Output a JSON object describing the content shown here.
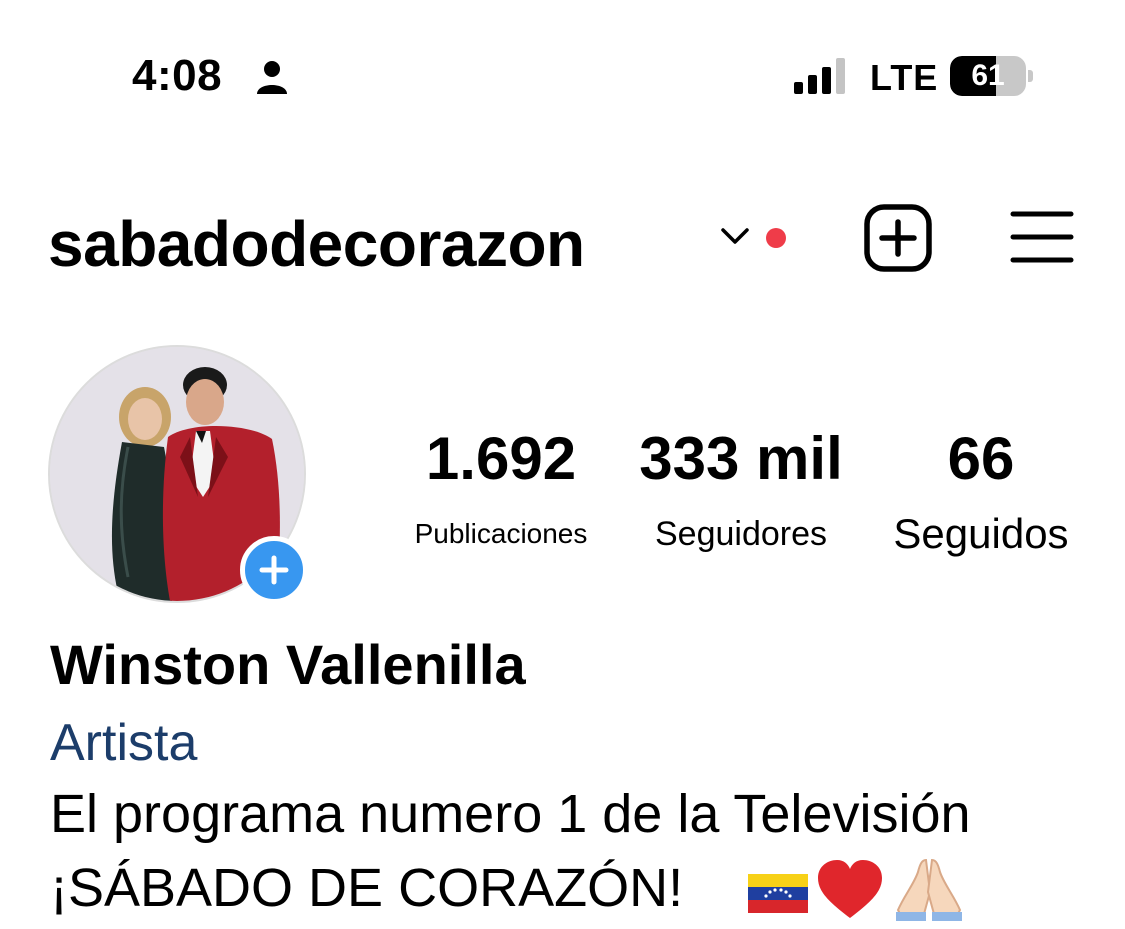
{
  "status_bar": {
    "time": "4:08",
    "network": "LTE",
    "battery_level": "61",
    "battery_fraction": 0.61,
    "icons": [
      "person-icon",
      "signal-icon",
      "battery-icon"
    ]
  },
  "header": {
    "username": "sabadodecorazon",
    "icons": [
      "chevron-down-icon",
      "notification-dot",
      "new-post-icon",
      "menu-icon"
    ],
    "notification_color": "#ef3c49"
  },
  "profile": {
    "avatar": "profile-photo",
    "add_story_icon": "plus-icon",
    "add_story_color": "#3897f0",
    "stats": [
      {
        "value": "1.692",
        "label": "Publicaciones"
      },
      {
        "value": "333 mil",
        "label": "Seguidores"
      },
      {
        "value": "66",
        "label": "Seguidos"
      }
    ],
    "display_name": "Winston Vallenilla",
    "category": "Artista",
    "category_color": "#1c3d6a",
    "bio_line1": "El programa numero 1 de la Televisión",
    "bio_line2": "¡SÁBADO DE CORAZÓN!",
    "bio_emojis": [
      "venezuela-flag-icon",
      "red-heart-icon",
      "praying-hands-icon"
    ]
  }
}
